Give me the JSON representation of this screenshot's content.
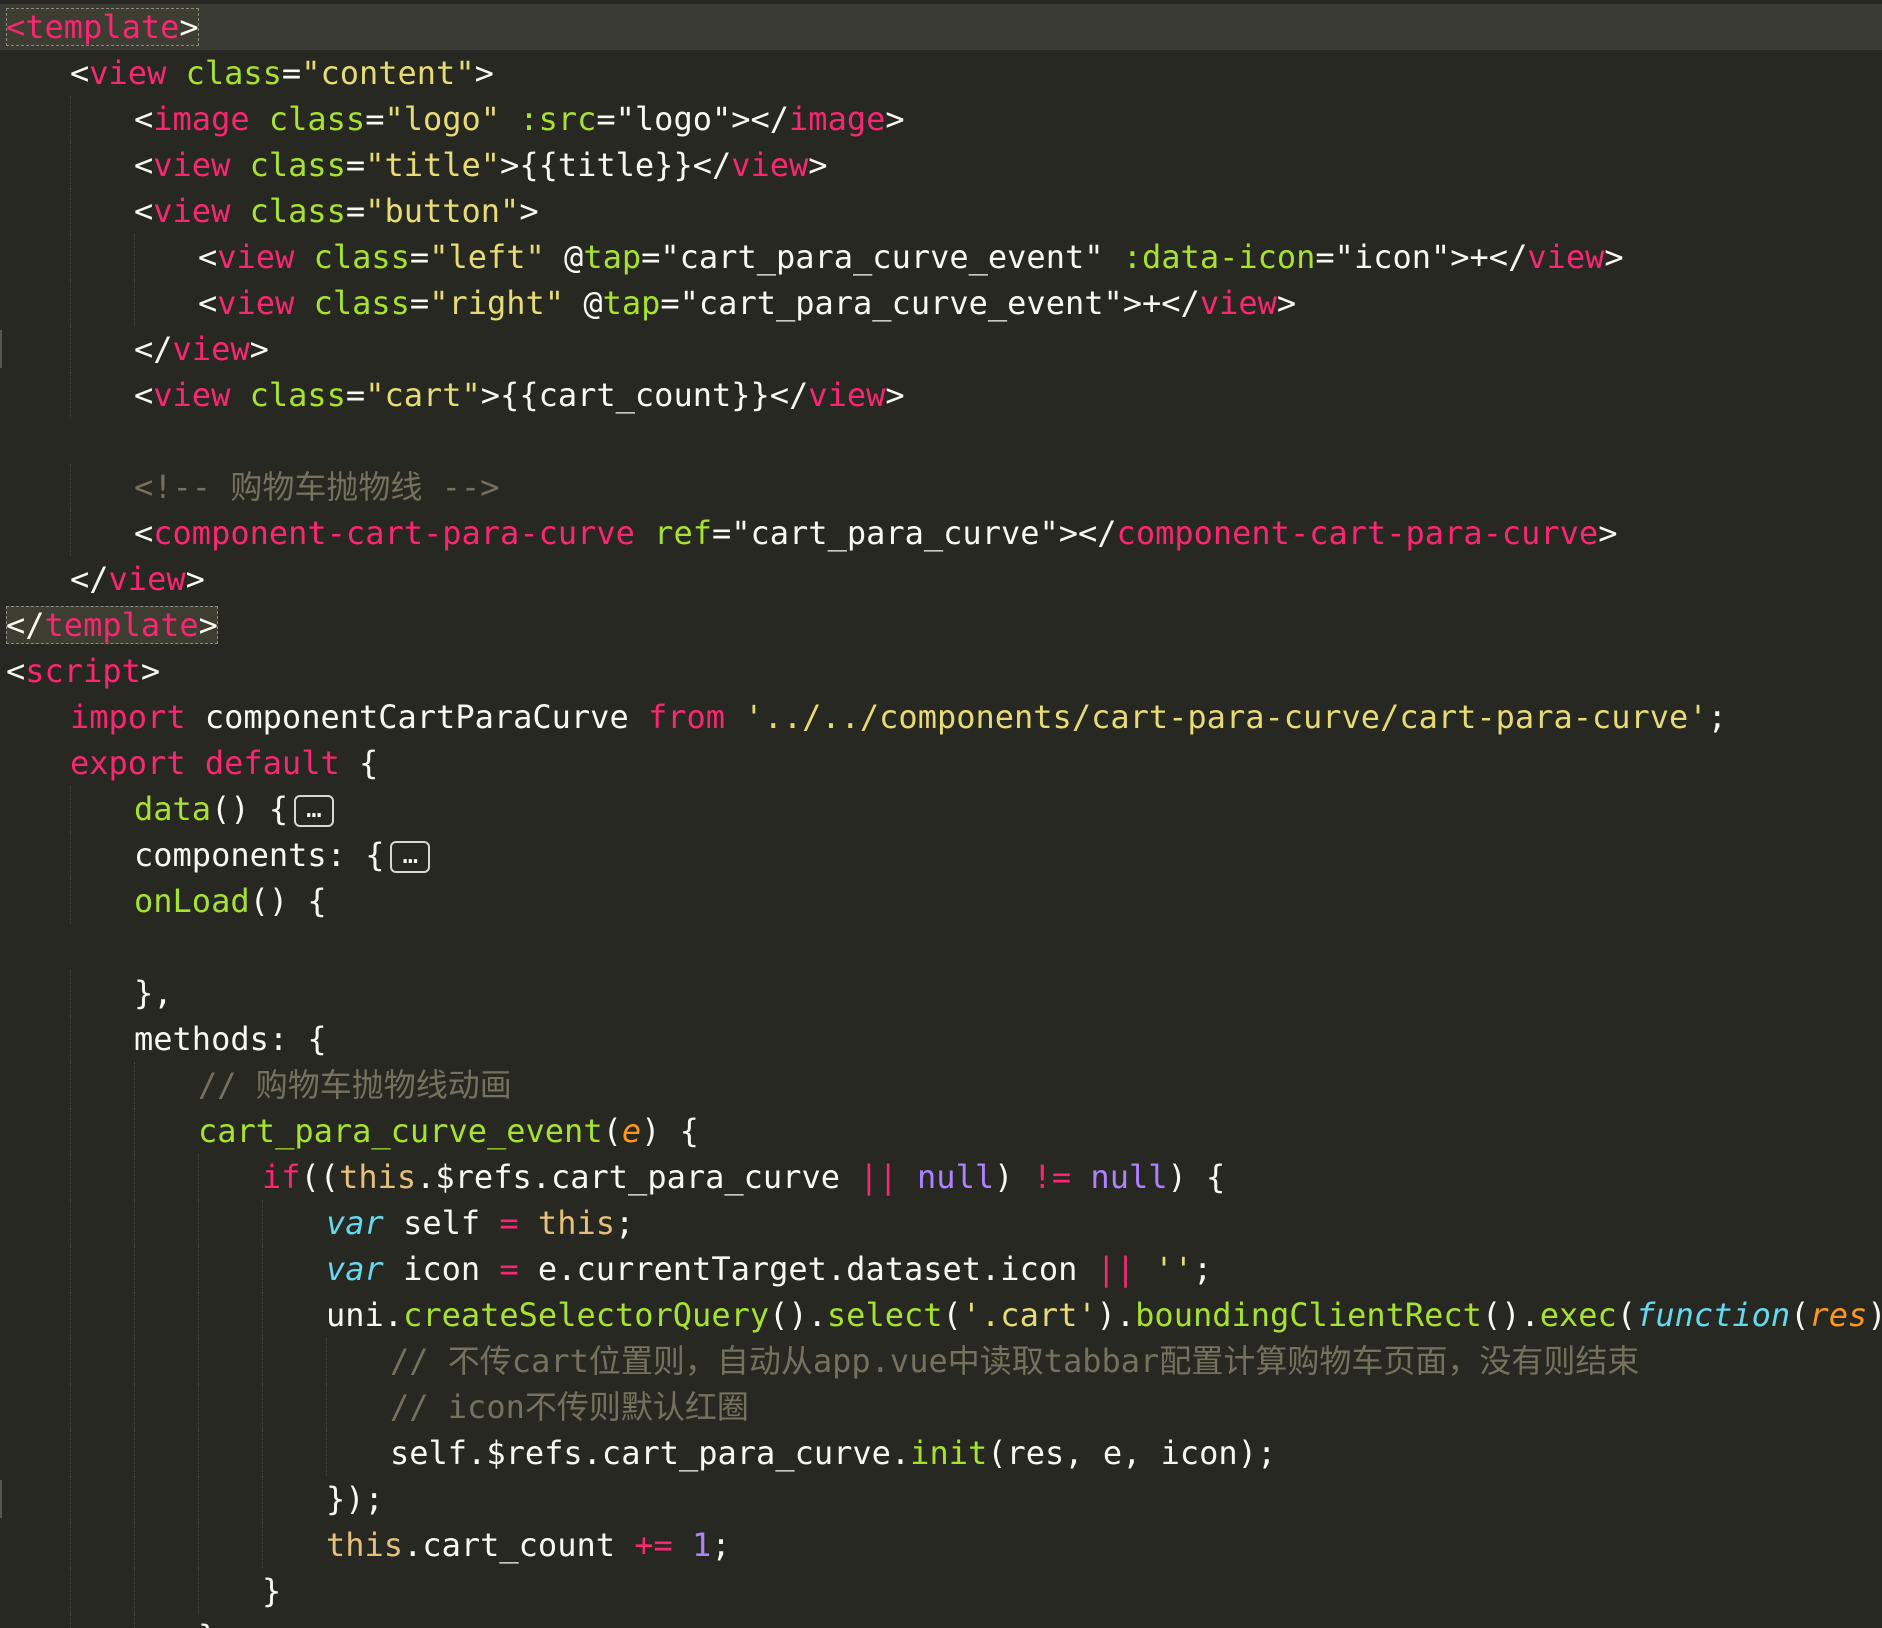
{
  "editor": {
    "theme": "monokai",
    "colors": {
      "background": "#272822",
      "text": "#F8F8F2",
      "tag": "#F92672",
      "attribute": "#A6E22E",
      "string": "#E6DB74",
      "comment": "#75715E",
      "number": "#AE81FF",
      "storage": "#66D9EF",
      "param": "#FD971F"
    },
    "fold_placeholder": "…",
    "lines": [
      {
        "indent": 0,
        "current": true,
        "tokens": [
          {
            "c": "t",
            "v": "<",
            "box": true
          },
          {
            "c": "t",
            "v": "template",
            "box": true
          },
          {
            "c": "p",
            "v": ">",
            "box": true
          }
        ]
      },
      {
        "indent": 1,
        "tokens": [
          {
            "c": "p",
            "v": "<"
          },
          {
            "c": "t",
            "v": "view"
          },
          {
            "c": "p",
            "v": " "
          },
          {
            "c": "a",
            "v": "class"
          },
          {
            "c": "p",
            "v": "="
          },
          {
            "c": "s",
            "v": "\"content\""
          },
          {
            "c": "p",
            "v": ">"
          }
        ]
      },
      {
        "indent": 2,
        "tokens": [
          {
            "c": "p",
            "v": "<"
          },
          {
            "c": "t",
            "v": "image"
          },
          {
            "c": "p",
            "v": " "
          },
          {
            "c": "a",
            "v": "class"
          },
          {
            "c": "p",
            "v": "="
          },
          {
            "c": "s",
            "v": "\"logo\""
          },
          {
            "c": "p",
            "v": " "
          },
          {
            "c": "a",
            "v": ":src"
          },
          {
            "c": "p",
            "v": "=\"logo\"></"
          },
          {
            "c": "t",
            "v": "image"
          },
          {
            "c": "p",
            "v": ">"
          }
        ]
      },
      {
        "indent": 2,
        "tokens": [
          {
            "c": "p",
            "v": "<"
          },
          {
            "c": "t",
            "v": "view"
          },
          {
            "c": "p",
            "v": " "
          },
          {
            "c": "a",
            "v": "class"
          },
          {
            "c": "p",
            "v": "="
          },
          {
            "c": "s",
            "v": "\"title\""
          },
          {
            "c": "p",
            "v": ">{{title}}</"
          },
          {
            "c": "t",
            "v": "view"
          },
          {
            "c": "p",
            "v": ">"
          }
        ]
      },
      {
        "indent": 2,
        "tokens": [
          {
            "c": "p",
            "v": "<"
          },
          {
            "c": "t",
            "v": "view"
          },
          {
            "c": "p",
            "v": " "
          },
          {
            "c": "a",
            "v": "class"
          },
          {
            "c": "p",
            "v": "="
          },
          {
            "c": "s",
            "v": "\"button\""
          },
          {
            "c": "p",
            "v": ">"
          }
        ]
      },
      {
        "indent": 3,
        "tokens": [
          {
            "c": "p",
            "v": "<"
          },
          {
            "c": "t",
            "v": "view"
          },
          {
            "c": "p",
            "v": " "
          },
          {
            "c": "a",
            "v": "class"
          },
          {
            "c": "p",
            "v": "="
          },
          {
            "c": "s",
            "v": "\"left\""
          },
          {
            "c": "p",
            "v": " @"
          },
          {
            "c": "a",
            "v": "tap"
          },
          {
            "c": "p",
            "v": "=\"cart_para_curve_event\" "
          },
          {
            "c": "a",
            "v": ":data-icon"
          },
          {
            "c": "p",
            "v": "=\"icon\">+</"
          },
          {
            "c": "t",
            "v": "view"
          },
          {
            "c": "p",
            "v": ">"
          }
        ]
      },
      {
        "indent": 3,
        "tokens": [
          {
            "c": "p",
            "v": "<"
          },
          {
            "c": "t",
            "v": "view"
          },
          {
            "c": "p",
            "v": " "
          },
          {
            "c": "a",
            "v": "class"
          },
          {
            "c": "p",
            "v": "="
          },
          {
            "c": "s",
            "v": "\"right\""
          },
          {
            "c": "p",
            "v": " @"
          },
          {
            "c": "a",
            "v": "tap"
          },
          {
            "c": "p",
            "v": "=\"cart_para_curve_event\">+</"
          },
          {
            "c": "t",
            "v": "view"
          },
          {
            "c": "p",
            "v": ">"
          }
        ]
      },
      {
        "indent": 2,
        "mark": true,
        "tokens": [
          {
            "c": "p",
            "v": "</"
          },
          {
            "c": "t",
            "v": "view"
          },
          {
            "c": "p",
            "v": ">"
          }
        ]
      },
      {
        "indent": 2,
        "tokens": [
          {
            "c": "p",
            "v": "<"
          },
          {
            "c": "t",
            "v": "view"
          },
          {
            "c": "p",
            "v": " "
          },
          {
            "c": "a",
            "v": "class"
          },
          {
            "c": "p",
            "v": "="
          },
          {
            "c": "s",
            "v": "\"cart\""
          },
          {
            "c": "p",
            "v": ">{{cart_count}}</"
          },
          {
            "c": "t",
            "v": "view"
          },
          {
            "c": "p",
            "v": ">"
          }
        ]
      },
      {
        "indent": 0,
        "tokens": []
      },
      {
        "indent": 2,
        "tokens": [
          {
            "c": "c",
            "v": "<!-- 购物车抛物线 -->"
          }
        ]
      },
      {
        "indent": 2,
        "tokens": [
          {
            "c": "p",
            "v": "<"
          },
          {
            "c": "t",
            "v": "component-cart-para-curve"
          },
          {
            "c": "p",
            "v": " "
          },
          {
            "c": "a",
            "v": "ref"
          },
          {
            "c": "p",
            "v": "=\"cart_para_curve\"></"
          },
          {
            "c": "t",
            "v": "component-cart-para-curve"
          },
          {
            "c": "p",
            "v": ">"
          }
        ]
      },
      {
        "indent": 1,
        "tokens": [
          {
            "c": "p",
            "v": "</"
          },
          {
            "c": "t",
            "v": "view"
          },
          {
            "c": "p",
            "v": ">"
          }
        ]
      },
      {
        "indent": 0,
        "tokens": [
          {
            "c": "p",
            "v": "</",
            "box": true
          },
          {
            "c": "t",
            "v": "template",
            "box": true
          },
          {
            "c": "p",
            "v": ">",
            "box": true
          }
        ]
      },
      {
        "indent": 0,
        "tokens": [
          {
            "c": "p",
            "v": "<"
          },
          {
            "c": "t",
            "v": "script"
          },
          {
            "c": "p",
            "v": ">"
          }
        ]
      },
      {
        "indent": 1,
        "tokens": [
          {
            "c": "k",
            "v": "import"
          },
          {
            "c": "p",
            "v": " componentCartParaCurve "
          },
          {
            "c": "k",
            "v": "from"
          },
          {
            "c": "p",
            "v": " "
          },
          {
            "c": "s",
            "v": "'../../components/cart-para-curve/cart-para-curve'"
          },
          {
            "c": "p",
            "v": ";"
          }
        ]
      },
      {
        "indent": 1,
        "tokens": [
          {
            "c": "k",
            "v": "export"
          },
          {
            "c": "p",
            "v": " "
          },
          {
            "c": "k",
            "v": "default"
          },
          {
            "c": "p",
            "v": " {"
          }
        ]
      },
      {
        "indent": 2,
        "fold": true,
        "tokens": [
          {
            "c": "f",
            "v": "data"
          },
          {
            "c": "p",
            "v": "() {"
          }
        ]
      },
      {
        "indent": 2,
        "fold": true,
        "tokens": [
          {
            "c": "p",
            "v": "components: {"
          }
        ]
      },
      {
        "indent": 2,
        "tokens": [
          {
            "c": "f",
            "v": "onLoad"
          },
          {
            "c": "p",
            "v": "() {"
          }
        ]
      },
      {
        "indent": 0,
        "tokens": []
      },
      {
        "indent": 2,
        "tokens": [
          {
            "c": "p",
            "v": "},"
          }
        ]
      },
      {
        "indent": 2,
        "tokens": [
          {
            "c": "p",
            "v": "methods: {"
          }
        ]
      },
      {
        "indent": 3,
        "tokens": [
          {
            "c": "c",
            "v": "// 购物车抛物线动画"
          }
        ]
      },
      {
        "indent": 3,
        "tokens": [
          {
            "c": "f",
            "v": "cart_para_curve_event"
          },
          {
            "c": "p",
            "v": "("
          },
          {
            "c": "o",
            "v": "e"
          },
          {
            "c": "p",
            "v": ") {"
          }
        ]
      },
      {
        "indent": 4,
        "tokens": [
          {
            "c": "k",
            "v": "if"
          },
          {
            "c": "p",
            "v": "(("
          },
          {
            "c": "y",
            "v": "this"
          },
          {
            "c": "p",
            "v": ".$refs.cart_para_curve "
          },
          {
            "c": "k",
            "v": "||"
          },
          {
            "c": "p",
            "v": " "
          },
          {
            "c": "n",
            "v": "null"
          },
          {
            "c": "p",
            "v": ") "
          },
          {
            "c": "k",
            "v": "!="
          },
          {
            "c": "p",
            "v": " "
          },
          {
            "c": "n",
            "v": "null"
          },
          {
            "c": "p",
            "v": ") {"
          }
        ]
      },
      {
        "indent": 5,
        "tokens": [
          {
            "c": "v",
            "v": "var"
          },
          {
            "c": "p",
            "v": " self "
          },
          {
            "c": "k",
            "v": "="
          },
          {
            "c": "p",
            "v": " "
          },
          {
            "c": "y",
            "v": "this"
          },
          {
            "c": "p",
            "v": ";"
          }
        ]
      },
      {
        "indent": 5,
        "tokens": [
          {
            "c": "v",
            "v": "var"
          },
          {
            "c": "p",
            "v": " icon "
          },
          {
            "c": "k",
            "v": "="
          },
          {
            "c": "p",
            "v": " e.currentTarget.dataset.icon "
          },
          {
            "c": "k",
            "v": "||"
          },
          {
            "c": "p",
            "v": " "
          },
          {
            "c": "s",
            "v": "''"
          },
          {
            "c": "p",
            "v": ";"
          }
        ]
      },
      {
        "indent": 5,
        "tokens": [
          {
            "c": "p",
            "v": "uni."
          },
          {
            "c": "f",
            "v": "createSelectorQuery"
          },
          {
            "c": "p",
            "v": "()."
          },
          {
            "c": "f",
            "v": "select"
          },
          {
            "c": "p",
            "v": "("
          },
          {
            "c": "s",
            "v": "'.cart'"
          },
          {
            "c": "p",
            "v": ")."
          },
          {
            "c": "f",
            "v": "boundingClientRect"
          },
          {
            "c": "p",
            "v": "()."
          },
          {
            "c": "f",
            "v": "exec"
          },
          {
            "c": "p",
            "v": "("
          },
          {
            "c": "v",
            "v": "function"
          },
          {
            "c": "p",
            "v": "("
          },
          {
            "c": "o",
            "v": "res"
          },
          {
            "c": "p",
            "v": ") {"
          }
        ]
      },
      {
        "indent": 6,
        "tokens": [
          {
            "c": "c",
            "v": "// 不传cart位置则，自动从app.vue中读取tabbar配置计算购物车页面，没有则结束"
          }
        ]
      },
      {
        "indent": 6,
        "tokens": [
          {
            "c": "c",
            "v": "// icon不传则默认红圈"
          }
        ]
      },
      {
        "indent": 6,
        "tokens": [
          {
            "c": "p",
            "v": "self.$refs.cart_para_curve."
          },
          {
            "c": "f",
            "v": "init"
          },
          {
            "c": "p",
            "v": "(res, e, icon);"
          }
        ]
      },
      {
        "indent": 5,
        "mark": true,
        "tokens": [
          {
            "c": "p",
            "v": "});"
          }
        ]
      },
      {
        "indent": 5,
        "tokens": [
          {
            "c": "y",
            "v": "this"
          },
          {
            "c": "p",
            "v": ".cart_count "
          },
          {
            "c": "k",
            "v": "+="
          },
          {
            "c": "p",
            "v": " "
          },
          {
            "c": "n",
            "v": "1"
          },
          {
            "c": "p",
            "v": ";"
          }
        ]
      },
      {
        "indent": 4,
        "tokens": [
          {
            "c": "p",
            "v": "}"
          }
        ]
      },
      {
        "indent": 3,
        "tokens": [
          {
            "c": "p",
            "v": "},"
          }
        ]
      }
    ]
  }
}
